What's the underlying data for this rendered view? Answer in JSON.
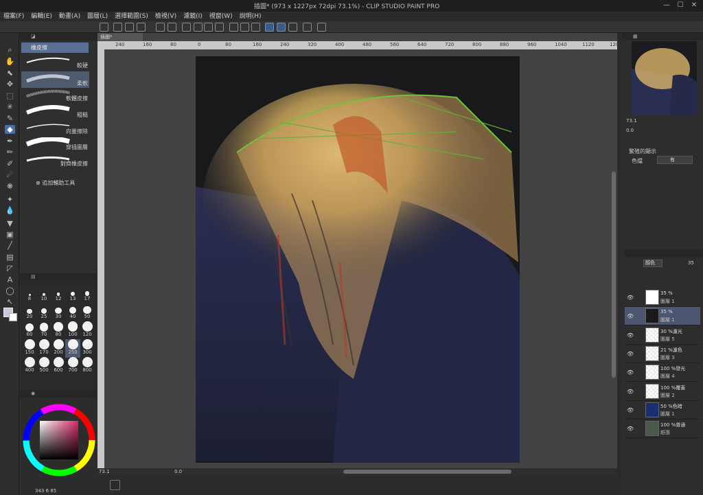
{
  "window": {
    "title": "插圖* (973 x 1227px 72dpi 73.1%)  - CLIP STUDIO PAINT PRO"
  },
  "menu": {
    "items": [
      "檔案(F)",
      "編輯(E)",
      "動畫(A)",
      "圖層(L)",
      "選擇範圍(S)",
      "檢視(V)",
      "濾鏡(I)",
      "視窗(W)",
      "說明(H)"
    ]
  },
  "doc_tab": {
    "label": "插圖*"
  },
  "ruler": {
    "ticks": [
      "240",
      "160",
      "80",
      "0",
      "80",
      "160",
      "240",
      "320",
      "400",
      "480",
      "560",
      "640",
      "720",
      "800",
      "880",
      "960",
      "1040",
      "1120",
      "1200"
    ]
  },
  "subtool": {
    "group": "橡皮擦",
    "brushes": [
      {
        "label": "較硬"
      },
      {
        "label": "柔軟"
      },
      {
        "label": "軟體皮擦"
      },
      {
        "label": "粗糙"
      },
      {
        "label": "向量擦除"
      },
      {
        "label": "穿插圖層"
      },
      {
        "label": "對齊橡皮擦"
      }
    ],
    "add_label": "追加輔助工具"
  },
  "brush_sizes": [
    "8",
    "10",
    "12",
    "13",
    "17",
    "20",
    "25",
    "30",
    "40",
    "50",
    "60",
    "70",
    "80",
    "100",
    "120",
    "150",
    "170",
    "200",
    "250",
    "300",
    "400",
    "500",
    "600",
    "700",
    "800"
  ],
  "color_panel": {
    "info": "343   6   85"
  },
  "navigator": {
    "zoom": "73.1",
    "angle": "0.0"
  },
  "tool_property": {
    "title": "繁殖的顯示",
    "label": "色擋",
    "value": "有"
  },
  "layers": {
    "blend_mode": "顏色",
    "opacity_value": "35",
    "items": [
      {
        "percent": "35 %",
        "name": "圖層 1",
        "thumb_color": "#ffffff"
      },
      {
        "percent": "35 %",
        "name": "圖層 1",
        "thumb_color": "#1a1a1a"
      },
      {
        "percent": "30 %濾光",
        "name": "圖層 5",
        "thumb_color": "checker"
      },
      {
        "percent": "21 %濾色",
        "name": "圖層 3",
        "thumb_color": "checker"
      },
      {
        "percent": "100 %發光",
        "name": "圖層 4",
        "thumb_color": "checker"
      },
      {
        "percent": "100 %覆蓋",
        "name": "圖層 2",
        "thumb_color": "checker"
      },
      {
        "percent": "50 %色暗",
        "name": "圖層 1",
        "thumb_color": "#1b2e6e"
      },
      {
        "percent": "100 %普通",
        "name": "紙張",
        "thumb_color": "#4a5a4a"
      }
    ]
  },
  "status": {
    "zoom": "73.1",
    "angle": "0.0"
  },
  "colors": {
    "accent": "#4a6ea8",
    "selected_layer": "#4c5670",
    "canvas_bg": "#434343"
  }
}
